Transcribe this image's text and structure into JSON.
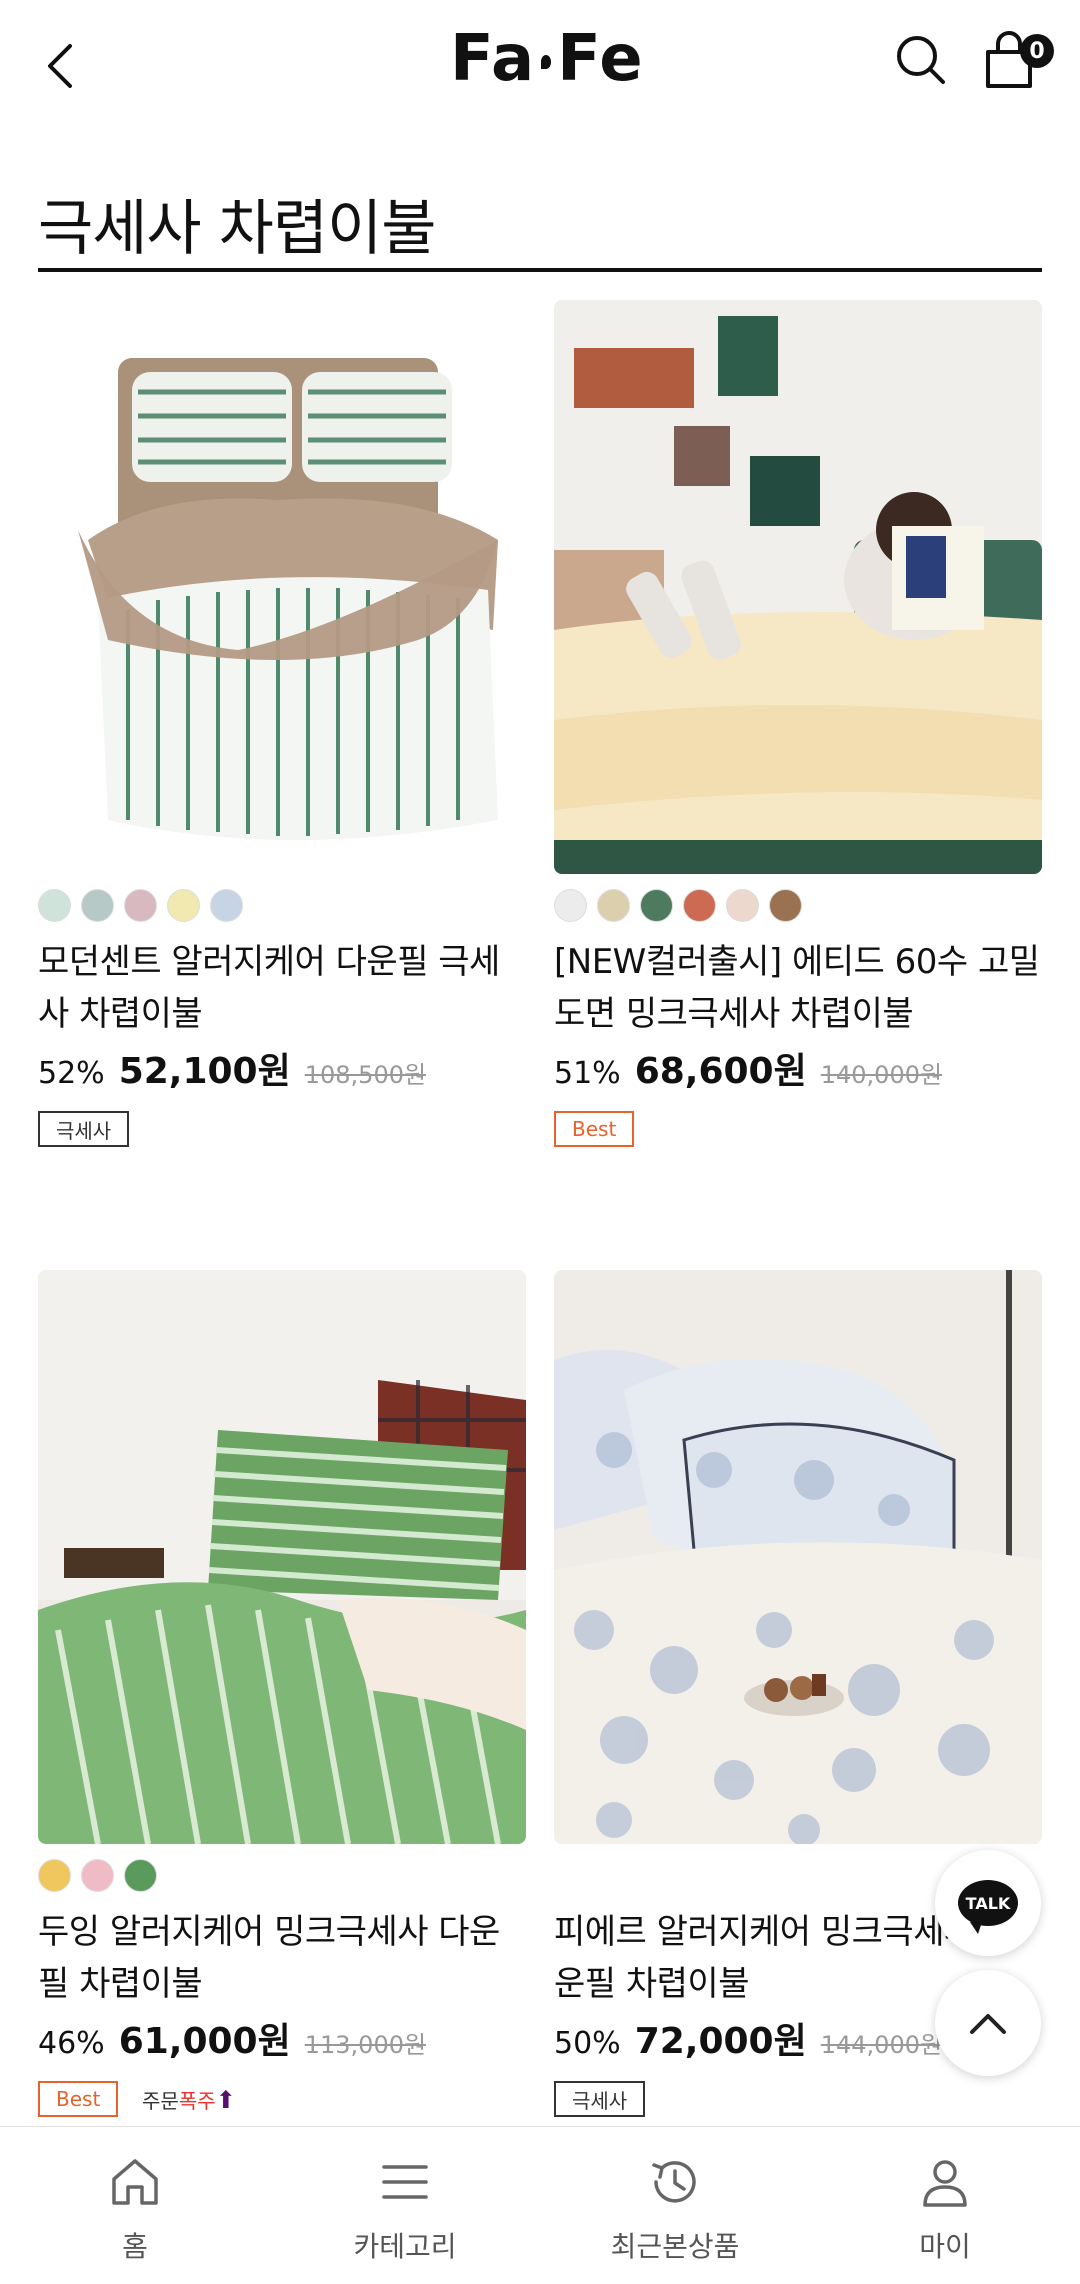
{
  "header": {
    "brand": "Fa,Fe",
    "brand_left": "Fa",
    "brand_right": "Fe",
    "cart_count": "0"
  },
  "page": {
    "title": "극세사 차렵이불"
  },
  "products": [
    {
      "name": "모던센트 알러지케어 다운필 극세사 차렵이불",
      "discount": "52%",
      "price": "52,100원",
      "original_price": "108,500원",
      "tag": "극세사",
      "swatches": [
        "#cfe3da",
        "#b7c9c6",
        "#d9b9c0",
        "#f1e9b0",
        "#c6d4e6"
      ]
    },
    {
      "name": "[NEW컬러출시] 에티드 60수 고밀도면 밍크극세사 차렵이불",
      "discount": "51%",
      "price": "68,600원",
      "original_price": "140,000원",
      "tag": "Best",
      "swatches": [
        "#ececec",
        "#dccfae",
        "#4e7a5f",
        "#cc6a52",
        "#ecd8cd",
        "#9a7251"
      ]
    },
    {
      "name": "두잉 알러지케어 밍크극세사 다운필 차렵이불",
      "discount": "46%",
      "price": "61,000원",
      "original_price": "113,000원",
      "tag": "Best",
      "hot_prefix": "주문",
      "hot_word": "폭주",
      "swatches": [
        "#f0c75e",
        "#efbcc6",
        "#5a9a5c"
      ]
    },
    {
      "name": "피에르 알러지케어 밍크극세사 다운필 차렵이불",
      "discount": "50%",
      "price": "72,000원",
      "original_price": "144,000원",
      "tag": "극세사",
      "swatches": []
    }
  ],
  "floating": {
    "talk_label": "TALK"
  },
  "nav": [
    {
      "label": "홈",
      "icon": "home-icon"
    },
    {
      "label": "카테고리",
      "icon": "menu-icon"
    },
    {
      "label": "최근본상품",
      "icon": "history-icon"
    },
    {
      "label": "마이",
      "icon": "user-icon"
    }
  ]
}
